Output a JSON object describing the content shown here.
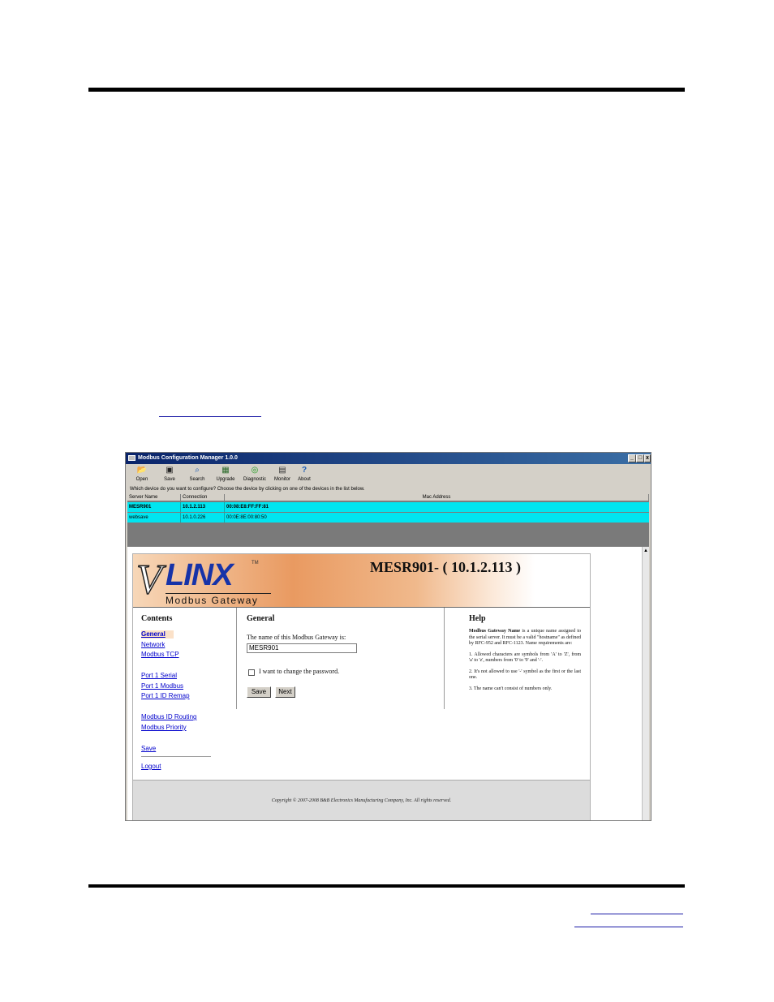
{
  "window": {
    "title": "Modbus Configuration Manager 1.0.0",
    "buttons": {
      "minimize": "_",
      "maximize": "□",
      "close": "x"
    }
  },
  "toolbar": {
    "items": [
      {
        "label": "Open",
        "icon": "open-folder-icon"
      },
      {
        "label": "Save",
        "icon": "floppy-disk-icon"
      },
      {
        "label": "Search",
        "icon": "magnifier-icon"
      },
      {
        "label": "Upgrade",
        "icon": "upgrade-icon"
      },
      {
        "label": "Diagnostic",
        "icon": "antenna-icon"
      },
      {
        "label": "Monitor",
        "icon": "monitor-icon"
      },
      {
        "label": "About",
        "icon": "question-icon"
      }
    ]
  },
  "device_list": {
    "prompt": "Which device do you want to configure? Choose the device by clicking on one of the devices in the list below.",
    "columns": [
      "Server Name",
      "Connection",
      "Mac Address"
    ],
    "rows": [
      {
        "name": "MESR901",
        "connection": "10.1.2.113",
        "mac": "00:08:E8:FF:FF:81"
      },
      {
        "name": "websave",
        "connection": "10.1.0.226",
        "mac": "00:0E:8E:00:80:50"
      }
    ]
  },
  "page": {
    "logo": {
      "v": "V",
      "linx": "LINX",
      "tm": "TM",
      "subtitle": "Modbus Gateway"
    },
    "device_title": "MESR901- ( 10.1.2.113 )",
    "nav": {
      "heading": "Contents",
      "items": [
        "General",
        "Network",
        "Modbus TCP",
        "Port 1 Serial",
        "Port 1 Modbus",
        "Port 1 ID Remap",
        "Modbus ID Routing",
        "Modbus Priority",
        "Save",
        "Logout"
      ]
    },
    "general": {
      "heading": "General",
      "name_label": "The name of this Modbus Gateway is:",
      "name_value": "MESR901",
      "password_label": "I want to change the password.",
      "save_label": "Save",
      "next_label": "Next"
    },
    "help": {
      "heading": "Help",
      "intro_term": "Modbus Gateway Name",
      "intro_text": " is a unique name assigned to the serial server. It must be a valid \"hostname\" as defined by RFC-952 and RFC-1123. Name requirements are:",
      "rule1": "1. Allowed characters are symbols from 'A' to 'Z', from 'a' to 'z', numbers from '0' to '9' and '-'.",
      "rule2": "2. It's not allowed to use '-' symbol as the first or the last one.",
      "rule3": "3. The name can't consist of numbers only."
    },
    "copyright": "Copyright © 2007-2008 B&B Electronics Manufacturing Company, Inc. All rights reserved."
  }
}
